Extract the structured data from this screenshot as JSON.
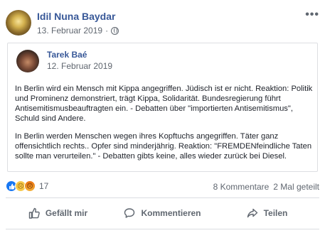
{
  "post": {
    "author": "Idil Nuna Baydar",
    "date": "13. Februar 2019",
    "more_label": "•••"
  },
  "shared": {
    "author": "Tarek Baé",
    "date": "12. Februar 2019",
    "paragraph1": "In Berlin wird ein Mensch mit Kippa angegriffen. Jüdisch ist er nicht. Reaktion: Politik und Prominenz demonstriert, trägt Kippa, Solidarität. Bundesregierung führt Antisemitismusbeauftragten ein. - Debatten über \"importierten Antisemitismus\", Schuld sind Andere.",
    "paragraph2": "In Berlin werden Menschen wegen ihres Kopftuchs angegriffen. Täter ganz offensichtlich rechts.. Opfer sind minderjährig. Reaktion: \"FREMDENfeindliche Taten sollte man verurteilen.\" - Debatten gibts keine, alles wieder zurück bei Diesel."
  },
  "stats": {
    "reaction_count": "17",
    "comments": "8 Kommentare",
    "shares": "2 Mal geteilt"
  },
  "actions": {
    "like": "Gefällt mir",
    "comment": "Kommentieren",
    "share": "Teilen"
  },
  "icons": [
    "globe-icon",
    "thumbs-up-icon",
    "comment-icon",
    "share-icon",
    "like-reaction-icon",
    "sad-reaction-icon",
    "angry-reaction-icon"
  ]
}
